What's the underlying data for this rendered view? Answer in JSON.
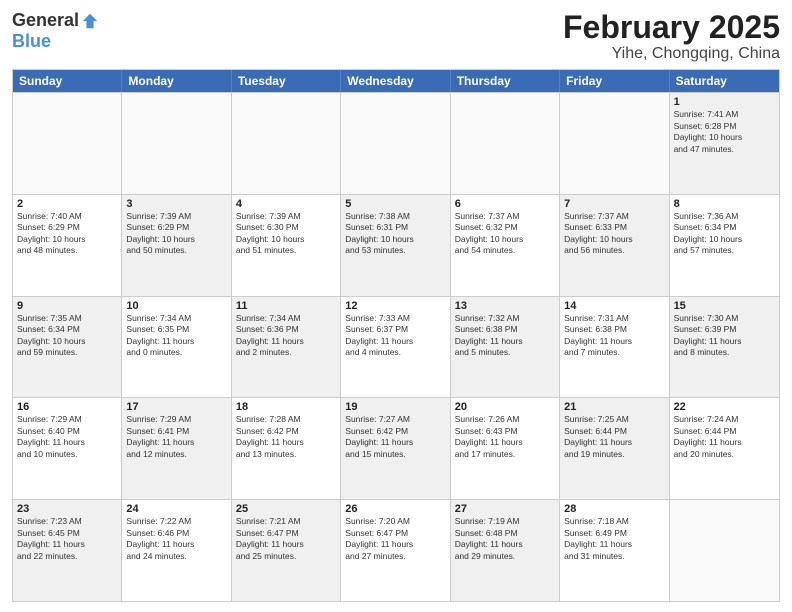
{
  "header": {
    "logo_general": "General",
    "logo_blue": "Blue",
    "title": "February 2025",
    "subtitle": "Yihe, Chongqing, China"
  },
  "calendar": {
    "days_of_week": [
      "Sunday",
      "Monday",
      "Tuesday",
      "Wednesday",
      "Thursday",
      "Friday",
      "Saturday"
    ],
    "rows": [
      [
        {
          "day": "",
          "empty": true
        },
        {
          "day": "",
          "empty": true
        },
        {
          "day": "",
          "empty": true
        },
        {
          "day": "",
          "empty": true
        },
        {
          "day": "",
          "empty": true
        },
        {
          "day": "",
          "empty": true
        },
        {
          "day": "1",
          "info": "Sunrise: 7:41 AM\nSunset: 6:28 PM\nDaylight: 10 hours\nand 47 minutes.",
          "shaded": true
        }
      ],
      [
        {
          "day": "2",
          "info": "Sunrise: 7:40 AM\nSunset: 6:29 PM\nDaylight: 10 hours\nand 48 minutes.",
          "shaded": false
        },
        {
          "day": "3",
          "info": "Sunrise: 7:39 AM\nSunset: 6:29 PM\nDaylight: 10 hours\nand 50 minutes.",
          "shaded": true
        },
        {
          "day": "4",
          "info": "Sunrise: 7:39 AM\nSunset: 6:30 PM\nDaylight: 10 hours\nand 51 minutes.",
          "shaded": false
        },
        {
          "day": "5",
          "info": "Sunrise: 7:38 AM\nSunset: 6:31 PM\nDaylight: 10 hours\nand 53 minutes.",
          "shaded": true
        },
        {
          "day": "6",
          "info": "Sunrise: 7:37 AM\nSunset: 6:32 PM\nDaylight: 10 hours\nand 54 minutes.",
          "shaded": false
        },
        {
          "day": "7",
          "info": "Sunrise: 7:37 AM\nSunset: 6:33 PM\nDaylight: 10 hours\nand 56 minutes.",
          "shaded": true
        },
        {
          "day": "8",
          "info": "Sunrise: 7:36 AM\nSunset: 6:34 PM\nDaylight: 10 hours\nand 57 minutes.",
          "shaded": false
        }
      ],
      [
        {
          "day": "9",
          "info": "Sunrise: 7:35 AM\nSunset: 6:34 PM\nDaylight: 10 hours\nand 59 minutes.",
          "shaded": true
        },
        {
          "day": "10",
          "info": "Sunrise: 7:34 AM\nSunset: 6:35 PM\nDaylight: 11 hours\nand 0 minutes.",
          "shaded": false
        },
        {
          "day": "11",
          "info": "Sunrise: 7:34 AM\nSunset: 6:36 PM\nDaylight: 11 hours\nand 2 minutes.",
          "shaded": true
        },
        {
          "day": "12",
          "info": "Sunrise: 7:33 AM\nSunset: 6:37 PM\nDaylight: 11 hours\nand 4 minutes.",
          "shaded": false
        },
        {
          "day": "13",
          "info": "Sunrise: 7:32 AM\nSunset: 6:38 PM\nDaylight: 11 hours\nand 5 minutes.",
          "shaded": true
        },
        {
          "day": "14",
          "info": "Sunrise: 7:31 AM\nSunset: 6:38 PM\nDaylight: 11 hours\nand 7 minutes.",
          "shaded": false
        },
        {
          "day": "15",
          "info": "Sunrise: 7:30 AM\nSunset: 6:39 PM\nDaylight: 11 hours\nand 8 minutes.",
          "shaded": true
        }
      ],
      [
        {
          "day": "16",
          "info": "Sunrise: 7:29 AM\nSunset: 6:40 PM\nDaylight: 11 hours\nand 10 minutes.",
          "shaded": false
        },
        {
          "day": "17",
          "info": "Sunrise: 7:29 AM\nSunset: 6:41 PM\nDaylight: 11 hours\nand 12 minutes.",
          "shaded": true
        },
        {
          "day": "18",
          "info": "Sunrise: 7:28 AM\nSunset: 6:42 PM\nDaylight: 11 hours\nand 13 minutes.",
          "shaded": false
        },
        {
          "day": "19",
          "info": "Sunrise: 7:27 AM\nSunset: 6:42 PM\nDaylight: 11 hours\nand 15 minutes.",
          "shaded": true
        },
        {
          "day": "20",
          "info": "Sunrise: 7:26 AM\nSunset: 6:43 PM\nDaylight: 11 hours\nand 17 minutes.",
          "shaded": false
        },
        {
          "day": "21",
          "info": "Sunrise: 7:25 AM\nSunset: 6:44 PM\nDaylight: 11 hours\nand 19 minutes.",
          "shaded": true
        },
        {
          "day": "22",
          "info": "Sunrise: 7:24 AM\nSunset: 6:44 PM\nDaylight: 11 hours\nand 20 minutes.",
          "shaded": false
        }
      ],
      [
        {
          "day": "23",
          "info": "Sunrise: 7:23 AM\nSunset: 6:45 PM\nDaylight: 11 hours\nand 22 minutes.",
          "shaded": true
        },
        {
          "day": "24",
          "info": "Sunrise: 7:22 AM\nSunset: 6:46 PM\nDaylight: 11 hours\nand 24 minutes.",
          "shaded": false
        },
        {
          "day": "25",
          "info": "Sunrise: 7:21 AM\nSunset: 6:47 PM\nDaylight: 11 hours\nand 25 minutes.",
          "shaded": true
        },
        {
          "day": "26",
          "info": "Sunrise: 7:20 AM\nSunset: 6:47 PM\nDaylight: 11 hours\nand 27 minutes.",
          "shaded": false
        },
        {
          "day": "27",
          "info": "Sunrise: 7:19 AM\nSunset: 6:48 PM\nDaylight: 11 hours\nand 29 minutes.",
          "shaded": true
        },
        {
          "day": "28",
          "info": "Sunrise: 7:18 AM\nSunset: 6:49 PM\nDaylight: 11 hours\nand 31 minutes.",
          "shaded": false
        },
        {
          "day": "",
          "empty": true
        }
      ]
    ]
  }
}
